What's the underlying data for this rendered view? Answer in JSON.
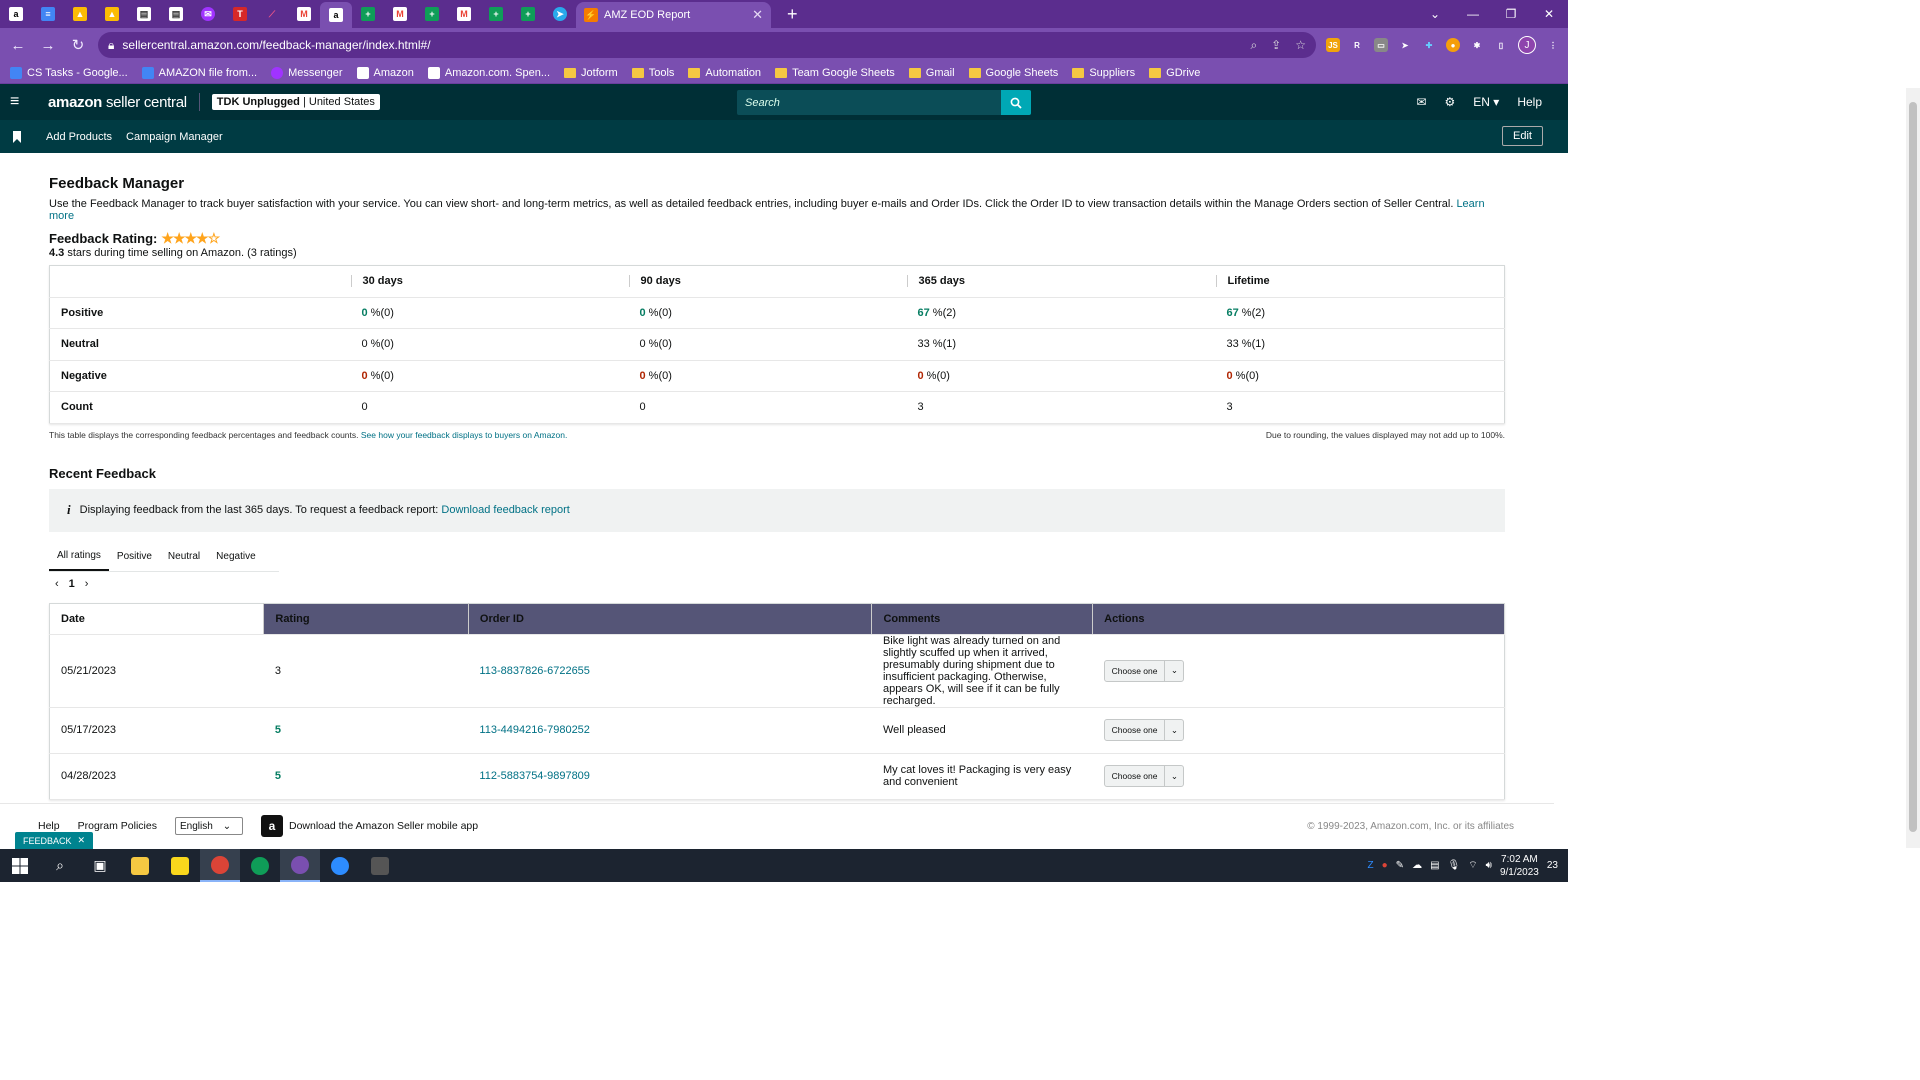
{
  "browser": {
    "active_tab_title": "AMZ EOD Report",
    "url": "sellercentral.amazon.com/feedback-manager/index.html#/",
    "bookmarks": [
      "CS Tasks - Google...",
      "AMAZON file from...",
      "Messenger",
      "Amazon",
      "Amazon.com. Spen...",
      "Jotform",
      "Tools",
      "Automation",
      "Team Google Sheets",
      "Gmail",
      "Google Sheets",
      "Suppliers",
      "GDrive"
    ],
    "profile_initial": "J"
  },
  "header": {
    "logo_bold": "amazon",
    "logo_light": "seller central",
    "account_name": "TDK Unplugged",
    "account_region": "United States",
    "search_placeholder": "Search",
    "language": "EN",
    "help": "Help"
  },
  "subnav": {
    "items": [
      "Add Products",
      "Campaign Manager"
    ],
    "edit": "Edit"
  },
  "page": {
    "title": "Feedback Manager",
    "description": "Use the Feedback Manager to track buyer satisfaction with your service. You can view short- and long-term metrics, as well as detailed feedback entries, including buyer e-mails and Order IDs. Click the Order ID to view transaction details within the Manage Orders section of Seller Central.",
    "learn_more": "Learn more",
    "rating_label": "Feedback Rating:",
    "rating_value": 4.3,
    "rating_value_text": "4.3",
    "rating_sub": "stars during time selling on Amazon. (3 ratings)"
  },
  "metrics": {
    "columns": [
      "30 days",
      "90 days",
      "365 days",
      "Lifetime"
    ],
    "rows": [
      {
        "label": "Positive",
        "cells": [
          [
            "0",
            " %(0)"
          ],
          [
            "0",
            " %(0)"
          ],
          [
            "67",
            " %(2)"
          ],
          [
            "67",
            " %(2)"
          ]
        ],
        "tone": "green"
      },
      {
        "label": "Neutral",
        "cells": [
          [
            "0",
            " %(0)"
          ],
          [
            "0",
            " %(0)"
          ],
          [
            "33",
            " %(1)"
          ],
          [
            "33",
            " %(1)"
          ]
        ],
        "tone": "plain"
      },
      {
        "label": "Negative",
        "cells": [
          [
            "0",
            " %(0)"
          ],
          [
            "0",
            " %(0)"
          ],
          [
            "0",
            " %(0)"
          ],
          [
            "0",
            " %(0)"
          ]
        ],
        "tone": "red"
      },
      {
        "label": "Count",
        "cells": [
          [
            "0",
            ""
          ],
          [
            "0",
            ""
          ],
          [
            "3",
            ""
          ],
          [
            "3",
            ""
          ]
        ],
        "tone": "plain"
      }
    ],
    "note_left": "This table displays the corresponding feedback percentages and feedback counts.",
    "note_link": "See how your feedback displays to buyers on Amazon.",
    "note_right": "Due to rounding, the values displayed may not add up to 100%."
  },
  "recent": {
    "title": "Recent Feedback",
    "info_text": "Displaying feedback from the last 365 days. To request a feedback report:",
    "info_link": "Download feedback report",
    "tabs": [
      "All ratings",
      "Positive",
      "Neutral",
      "Negative"
    ],
    "page": "1",
    "columns": [
      "Date",
      "Rating",
      "Order ID",
      "Comments",
      "Actions"
    ],
    "rows": [
      {
        "date": "05/21/2023",
        "rating": "3",
        "order_id": "113-8837826-6722655",
        "comment": "Bike light was already turned on and slightly scuffed up when it arrived, presumably during shipment due to insufficient packaging. Otherwise, appears OK, will see if it can be fully recharged.",
        "action": "Choose one"
      },
      {
        "date": "05/17/2023",
        "rating": "5",
        "order_id": "113-4494216-7980252",
        "comment": "Well pleased",
        "action": "Choose one"
      },
      {
        "date": "04/28/2023",
        "rating": "5",
        "order_id": "112-5883754-9897809",
        "comment": "My cat loves it! Packaging is very easy and convenient",
        "action": "Choose one"
      }
    ]
  },
  "footer": {
    "help": "Help",
    "policies": "Program Policies",
    "language": "English",
    "app": "Download the Amazon Seller mobile app",
    "copyright": "© 1999-2023, Amazon.com, Inc. or its affiliates",
    "feedback": "FEEDBACK"
  },
  "taskbar": {
    "time": "7:02 AM",
    "date": "9/1/2023",
    "notifications": "23"
  },
  "colors": {
    "tab_strip": "#5b2d8e",
    "header": "#002f36",
    "link": "#007185",
    "positive": "#067d62",
    "negative": "#b12704"
  }
}
